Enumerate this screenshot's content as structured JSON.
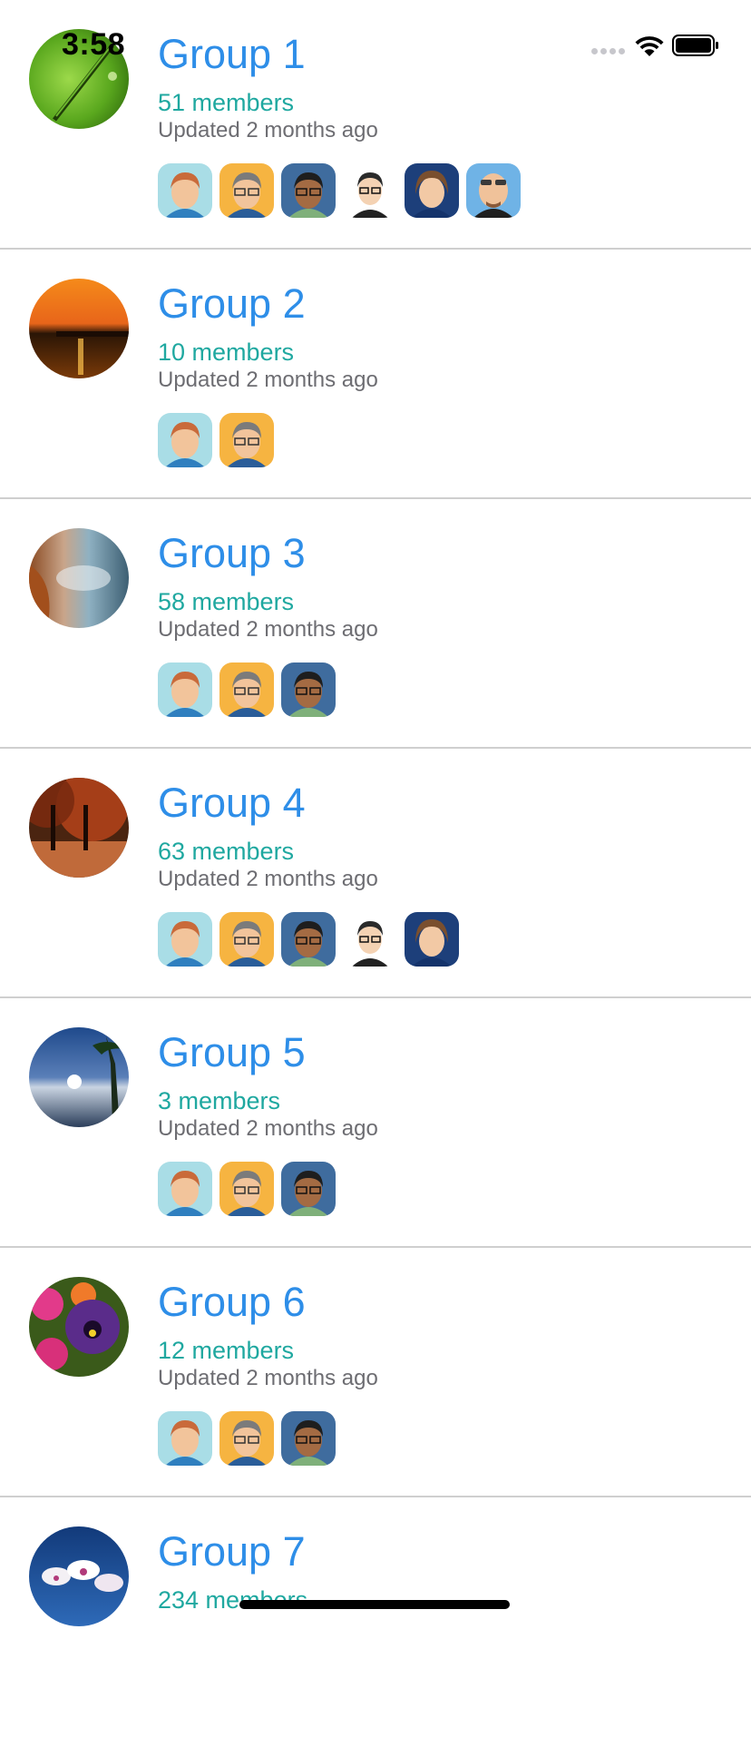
{
  "status_bar": {
    "time": "3:58"
  },
  "groups": [
    {
      "name": "Group 1",
      "members": "51 members",
      "updated": "Updated 2 months ago",
      "photo": "grass-dew-photo",
      "avatars": [
        "avatar-redhead-man",
        "avatar-gray-hair-glasses-man",
        "avatar-dark-skin-glasses-man",
        "avatar-dark-hair-glasses-man",
        "avatar-blue-hair-woman",
        "avatar-bald-sunglasses-man"
      ]
    },
    {
      "name": "Group 2",
      "members": "10 members",
      "updated": "Updated 2 months ago",
      "photo": "sunset-lake-photo",
      "avatars": [
        "avatar-redhead-man",
        "avatar-gray-hair-glasses-man"
      ]
    },
    {
      "name": "Group 3",
      "members": "58 members",
      "updated": "Updated 2 months ago",
      "photo": "coastal-rocks-photo",
      "avatars": [
        "avatar-redhead-man",
        "avatar-gray-hair-glasses-man",
        "avatar-dark-skin-glasses-man"
      ]
    },
    {
      "name": "Group 4",
      "members": "63 members",
      "updated": "Updated 2 months ago",
      "photo": "autumn-trees-photo",
      "avatars": [
        "avatar-redhead-man",
        "avatar-gray-hair-glasses-man",
        "avatar-dark-skin-glasses-man",
        "avatar-dark-hair-glasses-man",
        "avatar-blue-hair-woman"
      ]
    },
    {
      "name": "Group 5",
      "members": "3 members",
      "updated": "Updated 2 months ago",
      "photo": "tropical-sunset-photo",
      "avatars": [
        "avatar-redhead-man",
        "avatar-gray-hair-glasses-man",
        "avatar-dark-skin-glasses-man"
      ]
    },
    {
      "name": "Group 6",
      "members": "12 members",
      "updated": "Updated 2 months ago",
      "photo": "pansy-flowers-photo",
      "avatars": [
        "avatar-redhead-man",
        "avatar-gray-hair-glasses-man",
        "avatar-dark-skin-glasses-man"
      ]
    },
    {
      "name": "Group 7",
      "members": "234 members",
      "updated": "",
      "photo": "orchid-sky-photo",
      "avatars": []
    }
  ]
}
